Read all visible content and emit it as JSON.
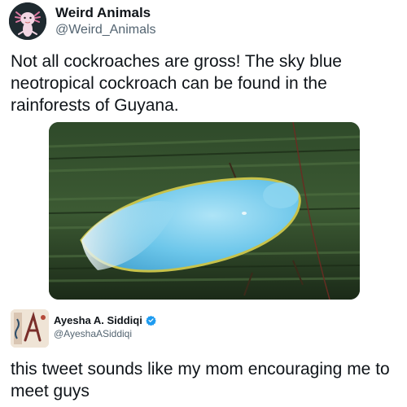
{
  "tweet": {
    "author_name": "Weird Animals",
    "author_handle": "@Weird_Animals",
    "avatar_icon": "axolotl-icon",
    "text": "Not all cockroaches are gross! The sky blue neotropical cockroach can be found in the rainforests of Guyana.",
    "media_icon": "blue-cockroach-photo"
  },
  "quote": {
    "author_name": "Ayesha A. Siddiqi",
    "author_handle": "@AyeshaASiddiqi",
    "verified_icon": "verified-badge-icon",
    "verified_color": "#1d9bf0",
    "text": "this tweet sounds like my mom encouraging me to meet guys"
  }
}
